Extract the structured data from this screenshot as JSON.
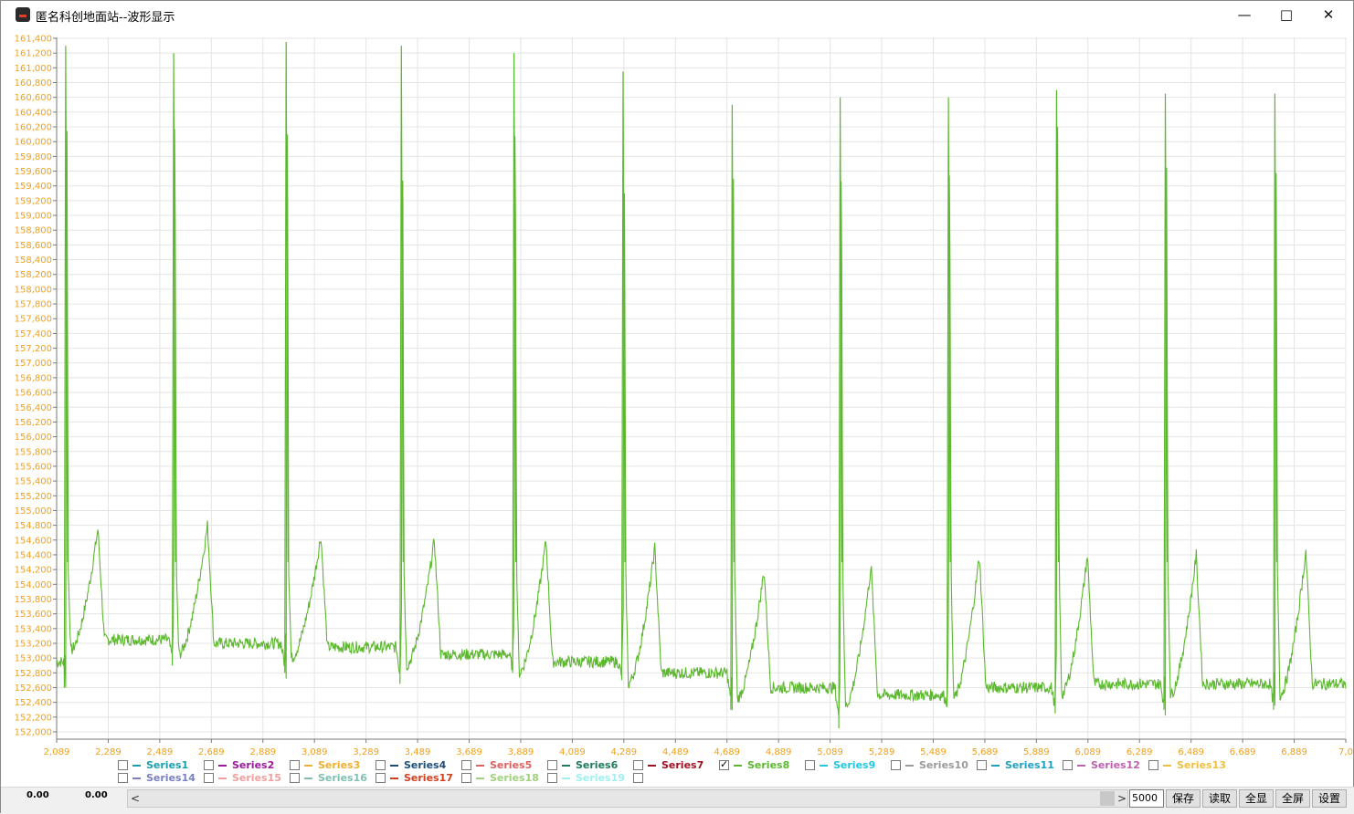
{
  "window": {
    "title": "匿名科创地面站--波形显示",
    "min_icon": "minimize-icon",
    "max_icon": "maximize-icon",
    "close_icon": "close-icon"
  },
  "chart_data": {
    "type": "line",
    "y_ticks": [
      "161,400",
      "161,200",
      "161,000",
      "160,800",
      "160,600",
      "160,400",
      "160,200",
      "160,000",
      "159,800",
      "159,600",
      "159,400",
      "159,200",
      "159,000",
      "158,800",
      "158,600",
      "158,400",
      "158,200",
      "158,000",
      "157,800",
      "157,600",
      "157,400",
      "157,200",
      "157,000",
      "156,800",
      "156,600",
      "156,400",
      "156,200",
      "156,000",
      "155,800",
      "155,600",
      "155,400",
      "155,200",
      "155,000",
      "154,800",
      "154,600",
      "154,400",
      "154,200",
      "154,000",
      "153,800",
      "153,600",
      "153,400",
      "153,200",
      "153,000",
      "152,800",
      "152,600",
      "152,400",
      "152,200",
      "152,000"
    ],
    "x_ticks": [
      "2,089",
      "2,289",
      "2,489",
      "2,689",
      "2,889",
      "3,089",
      "3,289",
      "3,489",
      "3,689",
      "3,889",
      "4,089",
      "4,289",
      "4,489",
      "4,689",
      "4,889",
      "5,089",
      "5,289",
      "5,489",
      "5,689",
      "5,889",
      "6,089",
      "6,289",
      "6,489",
      "6,689",
      "6,889",
      "7,0"
    ],
    "ylim": [
      152000,
      161400
    ],
    "xlim": [
      2089,
      7089
    ],
    "grid": true,
    "series": [
      {
        "name": "Series8",
        "color": "#5cb82e",
        "beats": [
          {
            "x": 2124,
            "peak": 161300,
            "twave_x": 2249,
            "twave": 154750,
            "base": 153250,
            "trough": 152600
          },
          {
            "x": 2543,
            "peak": 161200,
            "twave_x": 2674,
            "twave": 154800,
            "base": 153200,
            "trough": 152900
          },
          {
            "x": 2979,
            "peak": 161350,
            "twave_x": 3114,
            "twave": 154650,
            "base": 153150,
            "trough": 152800
          },
          {
            "x": 3426,
            "peak": 161300,
            "twave_x": 3554,
            "twave": 154600,
            "base": 153050,
            "trough": 152650
          },
          {
            "x": 3863,
            "peak": 161200,
            "twave_x": 3987,
            "twave": 154600,
            "base": 152950,
            "trough": 152800
          },
          {
            "x": 4286,
            "peak": 160950,
            "twave_x": 4409,
            "twave": 154500,
            "base": 152800,
            "trough": 152700
          },
          {
            "x": 4709,
            "peak": 160500,
            "twave_x": 4833,
            "twave": 154200,
            "base": 152600,
            "trough": 152300
          },
          {
            "x": 5128,
            "peak": 160600,
            "twave_x": 5248,
            "twave": 154250,
            "base": 152500,
            "trough": 152050
          },
          {
            "x": 5548,
            "peak": 160600,
            "twave_x": 5668,
            "twave": 154400,
            "base": 152600,
            "trough": 152350
          },
          {
            "x": 5967,
            "peak": 160700,
            "twave_x": 6087,
            "twave": 154400,
            "base": 152650,
            "trough": 152250
          },
          {
            "x": 6389,
            "peak": 160650,
            "twave_x": 6509,
            "twave": 154400,
            "base": 152650,
            "trough": 152300
          },
          {
            "x": 6814,
            "peak": 160650,
            "twave_x": 6934,
            "twave": 154450,
            "base": 152650,
            "trough": 152300
          }
        ]
      }
    ]
  },
  "legend": {
    "row1": [
      {
        "name": "Series1",
        "color": "#1a9fb0",
        "checked": false
      },
      {
        "name": "Series2",
        "color": "#9a1a9a",
        "checked": false
      },
      {
        "name": "Series3",
        "color": "#f0b030",
        "checked": false
      },
      {
        "name": "Series4",
        "color": "#1f4e79",
        "checked": false
      },
      {
        "name": "Series5",
        "color": "#e06060",
        "checked": false
      },
      {
        "name": "Series6",
        "color": "#1e7a5a",
        "checked": false
      },
      {
        "name": "Series7",
        "color": "#a01020",
        "checked": false
      },
      {
        "name": "Series8",
        "color": "#5cb82e",
        "checked": true
      },
      {
        "name": "Series9",
        "color": "#20c8e0",
        "checked": false
      },
      {
        "name": "Series10",
        "color": "#9a9a9a",
        "checked": false
      },
      {
        "name": "Series11",
        "color": "#20a0c0",
        "checked": false
      },
      {
        "name": "Series12",
        "color": "#c060b0",
        "checked": false
      },
      {
        "name": "Series13",
        "color": "#f0c040",
        "checked": false
      }
    ],
    "row2": [
      {
        "name": "Series14",
        "color": "#7a80c0",
        "checked": false
      },
      {
        "name": "Series15",
        "color": "#f0a0a0",
        "checked": false
      },
      {
        "name": "Series16",
        "color": "#80c0b0",
        "checked": false
      },
      {
        "name": "Series17",
        "color": "#d04020",
        "checked": false
      },
      {
        "name": "Series18",
        "color": "#a0d080",
        "checked": false
      },
      {
        "name": "Series19",
        "color": "#a0f0f0",
        "checked": false
      },
      {
        "name": "",
        "color": "#000000",
        "checked": false
      }
    ]
  },
  "statusbar": {
    "value1": "0.00",
    "value2": "0.00",
    "scroll_left": "<",
    "scroll_right": ">",
    "points": "5000",
    "save": "保存",
    "read": "读取",
    "show_all": "全显",
    "fullscreen": "全屏",
    "settings": "设置"
  }
}
